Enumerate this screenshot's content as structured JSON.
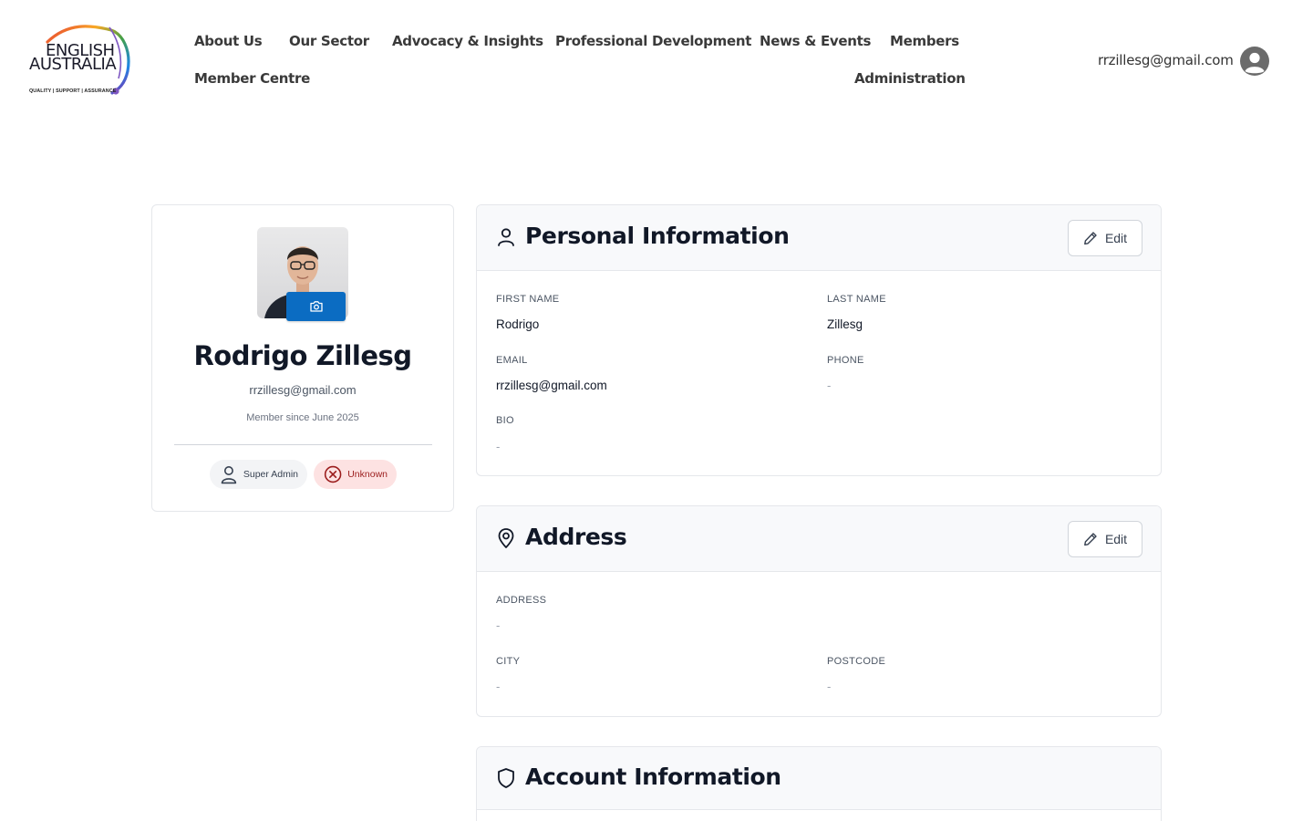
{
  "header": {
    "logo": {
      "line1": "ENGLISH",
      "line2": "AUSTRALIA",
      "tagline": "QUALITY | SUPPORT | ASSURANCE"
    },
    "nav": [
      "About Us",
      "Our Sector",
      "Advocacy & Insights",
      "Professional Development",
      "News & Events",
      "Members",
      "Member Centre",
      "Administration"
    ],
    "user_email": "rrzillesg@gmail.com",
    "user_icon": "user-circle-icon"
  },
  "profile": {
    "name": "Rodrigo Zillesg",
    "email": "rrzillesg@gmail.com",
    "member_since": "Member since June 2025",
    "camera_icon": "camera-icon",
    "badges": {
      "role": "Super Admin",
      "status": "Unknown"
    }
  },
  "sections": {
    "personal": {
      "title": "Personal Information",
      "edit_label": "Edit",
      "first_name_label": "FIRST NAME",
      "first_name": "Rodrigo",
      "last_name_label": "LAST NAME",
      "last_name": "Zillesg",
      "email_label": "EMAIL",
      "email": "rrzillesg@gmail.com",
      "phone_label": "PHONE",
      "phone": "-",
      "bio_label": "BIO",
      "bio": "-"
    },
    "address": {
      "title": "Address",
      "edit_label": "Edit",
      "address_label": "ADDRESS",
      "address": "-",
      "city_label": "CITY",
      "city": "-",
      "postcode_label": "POSTCODE",
      "postcode": "-"
    },
    "account": {
      "title": "Account Information"
    }
  },
  "colors": {
    "primary_button": "#0b6cc2",
    "status_badge_bg": "#fde2e2",
    "status_badge_text": "#9b1c1c",
    "section_header_bg": "#f8f9fb"
  }
}
